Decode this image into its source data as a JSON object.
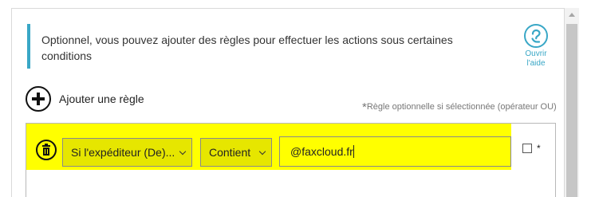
{
  "info": {
    "text": "Optionnel, vous pouvez ajouter des règles pour effectuer les actions sous certaines conditions"
  },
  "help": {
    "label_line1": "Ouvrir",
    "label_line2": "l'aide",
    "icon": "help-question-icon",
    "color": "#39a7c6"
  },
  "add_rule": {
    "label": "Ajouter une règle",
    "icon": "plus-circle-icon"
  },
  "note": {
    "star": "*",
    "text": "Règle optionnelle si sélectionnée (opérateur OU)"
  },
  "rule": {
    "highlight_color": "#ffff00",
    "field_select": "Si l'expéditeur (De)...",
    "operator_select": "Contient",
    "value": "@faxcloud.fr",
    "optional_checked": false,
    "required_star": "*"
  }
}
